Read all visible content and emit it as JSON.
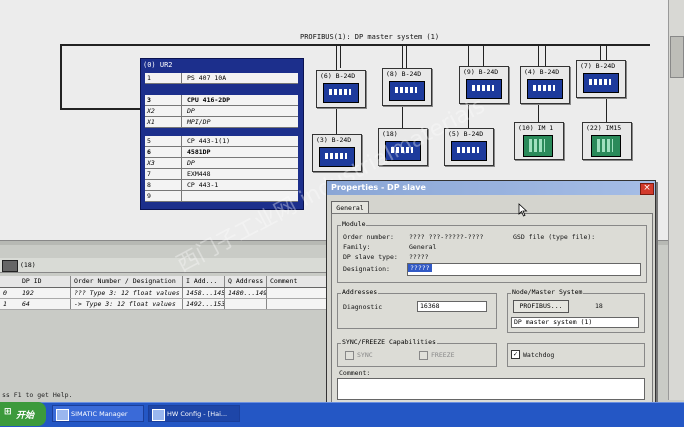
{
  "bus": {
    "title": "PROFIBUS(1): DP master system (1)"
  },
  "rack": {
    "title": "(0) UR2",
    "rows": [
      {
        "slot": "1",
        "module": "PS 407 10A",
        "style": "normal"
      },
      {
        "slot": "3",
        "module": "CPU 416-2DP",
        "style": "bold"
      },
      {
        "slot": "X2",
        "module": "DP",
        "style": "sub"
      },
      {
        "slot": "X1",
        "module": "MPI/DP",
        "style": "sub"
      },
      {
        "slot": "5",
        "module": "CP 443-1(1)",
        "style": "normal"
      },
      {
        "slot": "6",
        "module": "4581DP",
        "style": "bold"
      },
      {
        "slot": "X3",
        "module": "DP",
        "style": "sub"
      },
      {
        "slot": "7",
        "module": "EXM448",
        "style": "normal"
      },
      {
        "slot": "8",
        "module": "CP 443-1",
        "style": "normal"
      },
      {
        "slot": "9",
        "module": "",
        "style": "normal"
      }
    ]
  },
  "slaves": [
    {
      "label": "(6) B-24D",
      "kind": "blue"
    },
    {
      "label": "(8) B-24D",
      "kind": "blue"
    },
    {
      "label": "(9) B-24D",
      "kind": "blue"
    },
    {
      "label": "(4) B-24D",
      "kind": "blue"
    },
    {
      "label": "(7) B-24D",
      "kind": "blue"
    },
    {
      "label": "(3) B-24D",
      "kind": "blue"
    },
    {
      "label": "(18)",
      "kind": "blue"
    },
    {
      "label": "(5) B-24D",
      "kind": "blue"
    },
    {
      "label": "(10) IM 1",
      "kind": "green"
    },
    {
      "label": "(22) IM15",
      "kind": "green"
    }
  ],
  "lower": {
    "nav_label": "(18)",
    "headers": [
      "DP ID",
      "Order Number / Designation",
      "I Add...",
      "Q Address",
      "Comment"
    ],
    "rows": [
      {
        "slot": "0",
        "id": "192",
        "order": "??? Type 3: 12 float values",
        "i_add": "1458...145",
        "q_add": "1480...1495",
        "comment": ""
      },
      {
        "slot": "1",
        "id": "64",
        "order": "-> Type 3: 12 float values",
        "i_add": "1492...153",
        "q_add": "",
        "comment": ""
      }
    ]
  },
  "status": {
    "help": "ss F1 to get Help."
  },
  "dialog": {
    "title": "Properties - DP slave",
    "tab": "General",
    "module_group": "Module",
    "order_number_label": "Order number:",
    "order_number_value": "???? ???-?????-????",
    "gsd_label": "GSD file (type file):",
    "family_label": "Family:",
    "family_value": "General",
    "slave_type_label": "DP slave type:",
    "slave_type_value": "?????",
    "designation_label": "Designation:",
    "designation_value": "?????",
    "addresses_group": "Addresses",
    "diagnostic_label": "Diagnostic",
    "diagnostic_value": "16368",
    "node_group": "Node/Master System",
    "profibus_button": "PROFIBUS...",
    "node_address": "18",
    "master_system": "DP master system (1)",
    "sync_group": "SYNC/FREEZE Capabilities",
    "sync_label": "SYNC",
    "freeze_label": "FREEZE",
    "watchdog_label": "Watchdog",
    "comment_label": "Comment:"
  },
  "taskbar": {
    "start": "开始",
    "tasks": [
      "SIMATIC Manager",
      "HW Config - [Hai..."
    ]
  },
  "watermark": "西门子工业网 industrialmaterials"
}
